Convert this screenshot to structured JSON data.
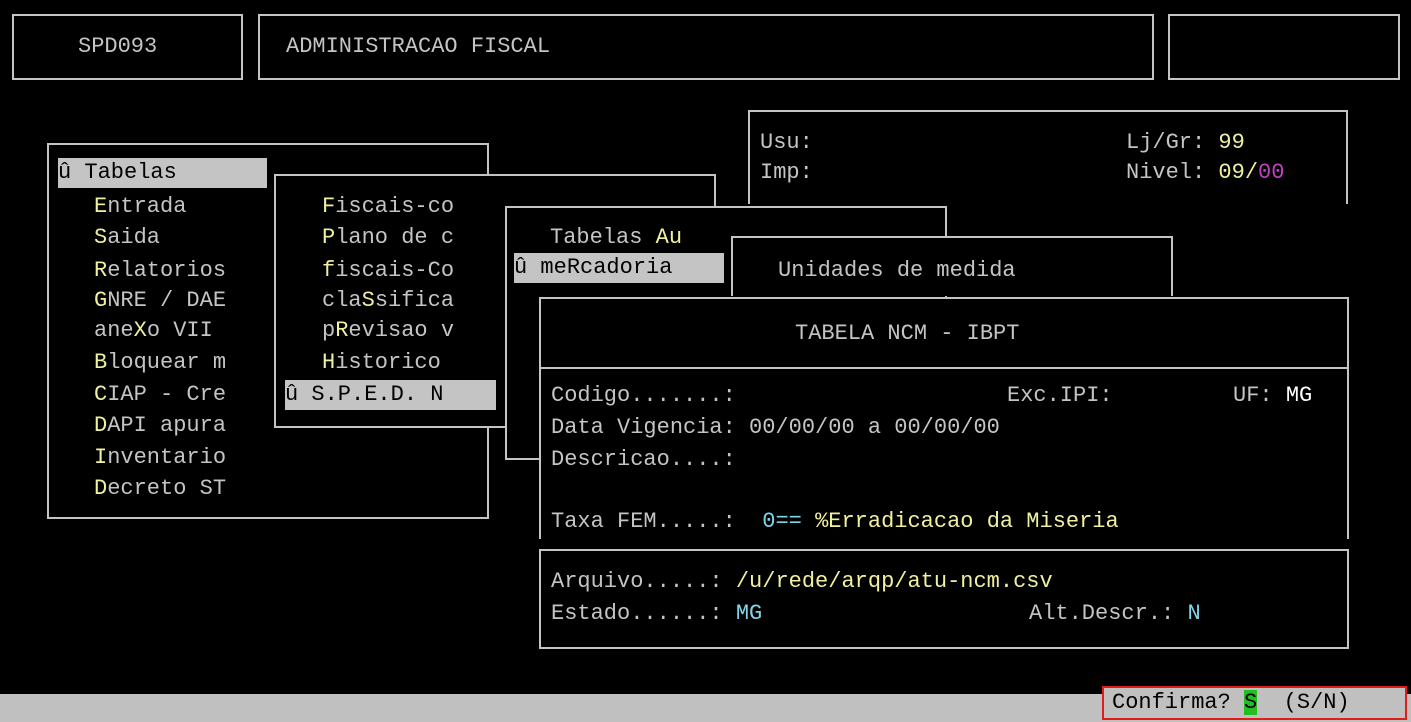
{
  "header": {
    "program_code": "SPD093",
    "title": "ADMINISTRACAO FISCAL"
  },
  "info": {
    "usu_label": "Usu:",
    "imp_label": "Imp:",
    "lj_label": "Lj/Gr:",
    "lj_value": "99",
    "nivel_label": "Nivel:",
    "nivel_value": "09/",
    "nivel_sub": "00"
  },
  "menu1": {
    "selected_marker": "û",
    "items": [
      {
        "hot": "",
        "rest": "Tabelas"
      },
      {
        "hot": "E",
        "rest": "ntrada"
      },
      {
        "hot": "S",
        "rest": "aida"
      },
      {
        "hot": "R",
        "rest": "elatorios"
      },
      {
        "hot": "G",
        "rest": "NRE / DAE"
      },
      {
        "pre": "ane",
        "hot": "X",
        "rest": "o VII"
      },
      {
        "hot": "B",
        "rest": "loquear m"
      },
      {
        "hot": "C",
        "rest": "IAP - Cre"
      },
      {
        "hot": "D",
        "rest": "API apura"
      },
      {
        "hot": "I",
        "rest": "nventario"
      },
      {
        "hot": "D",
        "rest": "ecreto ST"
      }
    ]
  },
  "menu2": {
    "items": [
      {
        "hot": "F",
        "rest": "iscais-co"
      },
      {
        "hot": "P",
        "rest": "lano de c"
      },
      {
        "hot": "f",
        "rest": "iscais-Co"
      },
      {
        "pre": "cla",
        "hot": "S",
        "rest": "sifica"
      },
      {
        "pre": "p",
        "hot": "R",
        "rest": "evisao v"
      },
      {
        "hot": "H",
        "rest": "istorico"
      },
      {
        "hot": "",
        "rest": "S.P.E.D. N"
      }
    ]
  },
  "menu3": {
    "items": [
      {
        "pre": "Tabelas ",
        "hot": "Au",
        "rest": ""
      },
      {
        "pre": "me",
        "hot": "R",
        "rest": "cadoria"
      }
    ]
  },
  "menu4": {
    "item": "Unidades de medida"
  },
  "ncm": {
    "title": "TABELA NCM - IBPT",
    "codigo_label": "Codigo.......:",
    "exc_ipi_label": "Exc.IPI:",
    "uf_label": "UF:",
    "uf_value": "MG",
    "data_vigencia": "Data Vigencia: 00/00/00 a 00/00/00",
    "descricao_label": "Descricao....:",
    "taxa_label": "Taxa FEM.....:",
    "taxa_value": "0==",
    "taxa_desc": "%Erradicacao da Miseria"
  },
  "arquivo": {
    "arquivo_label": "Arquivo.....:",
    "arquivo_value": "/u/rede/arqp/atu-ncm.csv",
    "estado_label": "Estado......:",
    "estado_value": "MG",
    "alt_label": "Alt.Descr.:",
    "alt_value": "N"
  },
  "status": {
    "prompt": "Confirma?",
    "answer": "S",
    "options": "(S/N)"
  }
}
